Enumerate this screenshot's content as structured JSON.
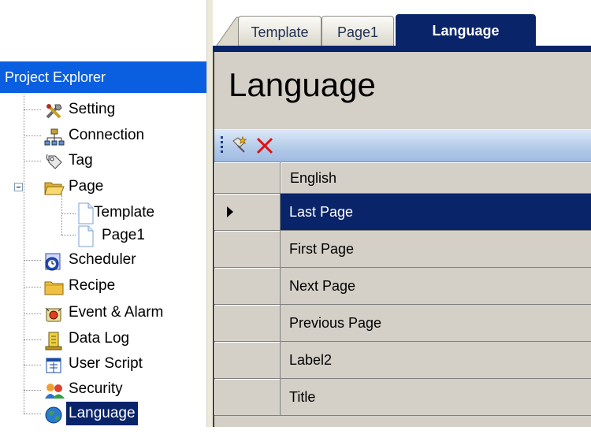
{
  "explorer": {
    "title": "Project Explorer",
    "items": [
      {
        "label": "Setting",
        "icon": "tools-icon"
      },
      {
        "label": "Connection",
        "icon": "network-icon"
      },
      {
        "label": "Tag",
        "icon": "tag-icon"
      },
      {
        "label": "Page",
        "icon": "folder-open-icon"
      },
      {
        "label": "Template",
        "icon": "page-icon"
      },
      {
        "label": "Page1",
        "icon": "page-icon"
      },
      {
        "label": "Scheduler",
        "icon": "clock-icon"
      },
      {
        "label": "Recipe",
        "icon": "folder-icon"
      },
      {
        "label": "Event & Alarm",
        "icon": "alarm-icon"
      },
      {
        "label": "Data Log",
        "icon": "data-log-icon"
      },
      {
        "label": "User Script",
        "icon": "script-icon"
      },
      {
        "label": "Security",
        "icon": "users-icon"
      },
      {
        "label": "Language",
        "icon": "globe-icon"
      }
    ],
    "selected": "Language"
  },
  "tabs": [
    {
      "label": "Template"
    },
    {
      "label": "Page1"
    },
    {
      "label": "Language",
      "active": true
    }
  ],
  "document": {
    "title": "Language"
  },
  "toolbar": {
    "buttons": [
      {
        "name": "new-icon"
      },
      {
        "name": "delete-icon"
      }
    ]
  },
  "grid": {
    "columns": [
      "English"
    ],
    "rows": [
      "Last Page",
      "First Page",
      "Next Page",
      "Previous Page",
      "Label2",
      "Title"
    ],
    "selected_row": 0
  },
  "colors": {
    "selection": "#0a246a",
    "explorer_header": "#0a5fe0",
    "toolbar": "#b4cbe9",
    "grid_bg": "#d4d0c8"
  }
}
